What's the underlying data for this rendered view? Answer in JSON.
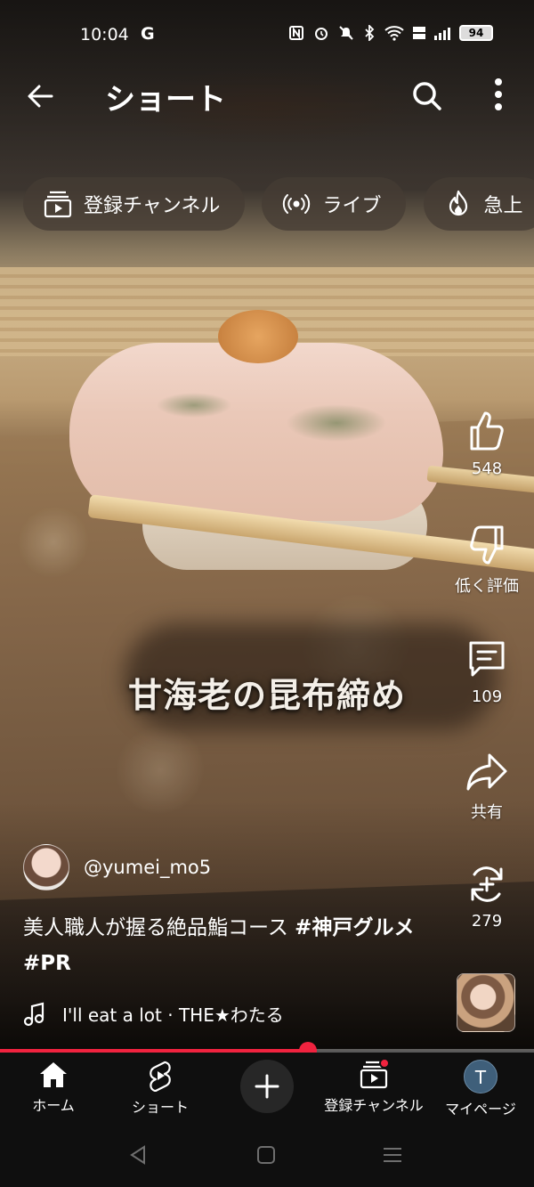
{
  "status_bar": {
    "time": "10:04",
    "g": "G",
    "battery": "94"
  },
  "header": {
    "title": "ショート"
  },
  "chips": [
    {
      "label": "登録チャンネル",
      "icon": "subscriptions-icon"
    },
    {
      "label": "ライブ",
      "icon": "live-icon"
    },
    {
      "label": "急上",
      "icon": "trending-icon"
    }
  ],
  "video": {
    "caption": "甘海老の昆布締め",
    "progress": 0.577
  },
  "rail": {
    "like_count": "548",
    "dislike_label": "低く評価",
    "comment_count": "109",
    "share_label": "共有",
    "remix_count": "279"
  },
  "channel": {
    "handle": "@yumei_mo5"
  },
  "description": {
    "text": "美人職人が握る絶品鮨コース ",
    "tag1": "#神戸グルメ",
    "space": " ",
    "tag2": "#PR"
  },
  "music": {
    "title": "I'll eat a lot · THE★わたる"
  },
  "bottom_nav": {
    "home": "ホーム",
    "shorts": "ショート",
    "subscriptions": "登録チャンネル",
    "me": "マイページ",
    "me_initial": "T"
  },
  "colors": {
    "accent": "#f0233f",
    "nav_bg": "#0f0f0f"
  }
}
